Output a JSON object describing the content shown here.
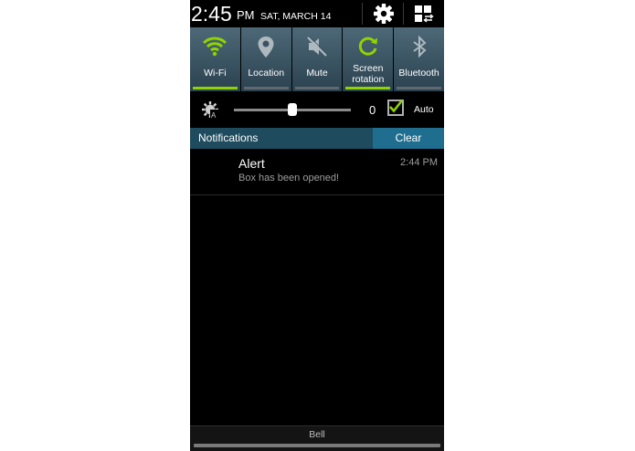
{
  "status_bar": {
    "time": "2:45",
    "ampm": "PM",
    "date": "SAT, MARCH 14",
    "settings_icon": "gear-icon",
    "grid_icon": "quick-settings-grid-icon"
  },
  "quick_toggles": [
    {
      "label": "Wi-Fi",
      "icon": "wifi-icon",
      "on": true
    },
    {
      "label": "Location",
      "icon": "location-pin-icon",
      "on": false
    },
    {
      "label": "Mute",
      "icon": "mute-icon",
      "on": false
    },
    {
      "label": "Screen\nrotation",
      "icon": "screen-rotation-icon",
      "on": true
    },
    {
      "label": "Bluetooth",
      "icon": "bluetooth-icon",
      "on": false
    }
  ],
  "brightness": {
    "icon": "brightness-auto-icon",
    "level": 0.5,
    "value": "0",
    "auto_label": "Auto",
    "auto_checked": true
  },
  "notifications": {
    "header": "Notifications",
    "clear_label": "Clear",
    "items": [
      {
        "title": "Alert",
        "body": "Box has been opened!",
        "time": "2:44 PM"
      }
    ]
  },
  "bottom_bar": {
    "label": "Bell"
  },
  "colors": {
    "accent_green": "#8fd400",
    "header_blue": "#1e4b5e",
    "clear_blue": "#1f6e8f"
  }
}
